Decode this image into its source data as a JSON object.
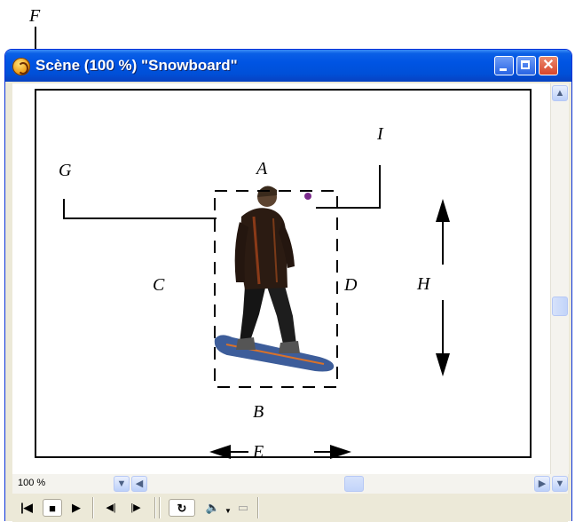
{
  "callouts": {
    "F": "F",
    "G": "G",
    "A": "A",
    "I": "I",
    "C": "C",
    "D": "D",
    "H": "H",
    "B": "B",
    "E": "E"
  },
  "window": {
    "title": "Scène (100 %) \"Snowboard\""
  },
  "zoom": {
    "value": "100 %"
  },
  "icons": [
    "app-icon",
    "minimize-icon",
    "maximize-icon",
    "close-icon",
    "scroll-up-icon",
    "scroll-down-icon",
    "scroll-left-icon",
    "scroll-right-icon",
    "rewind-icon",
    "stop-icon",
    "play-icon",
    "step-back-icon",
    "step-forward-icon",
    "loop-icon",
    "volume-icon",
    "chevron-down-icon",
    "speaker-icon"
  ],
  "colors": {
    "titlebar": "#0054e3",
    "close": "#d8452b",
    "frame": "#ece9d8"
  }
}
